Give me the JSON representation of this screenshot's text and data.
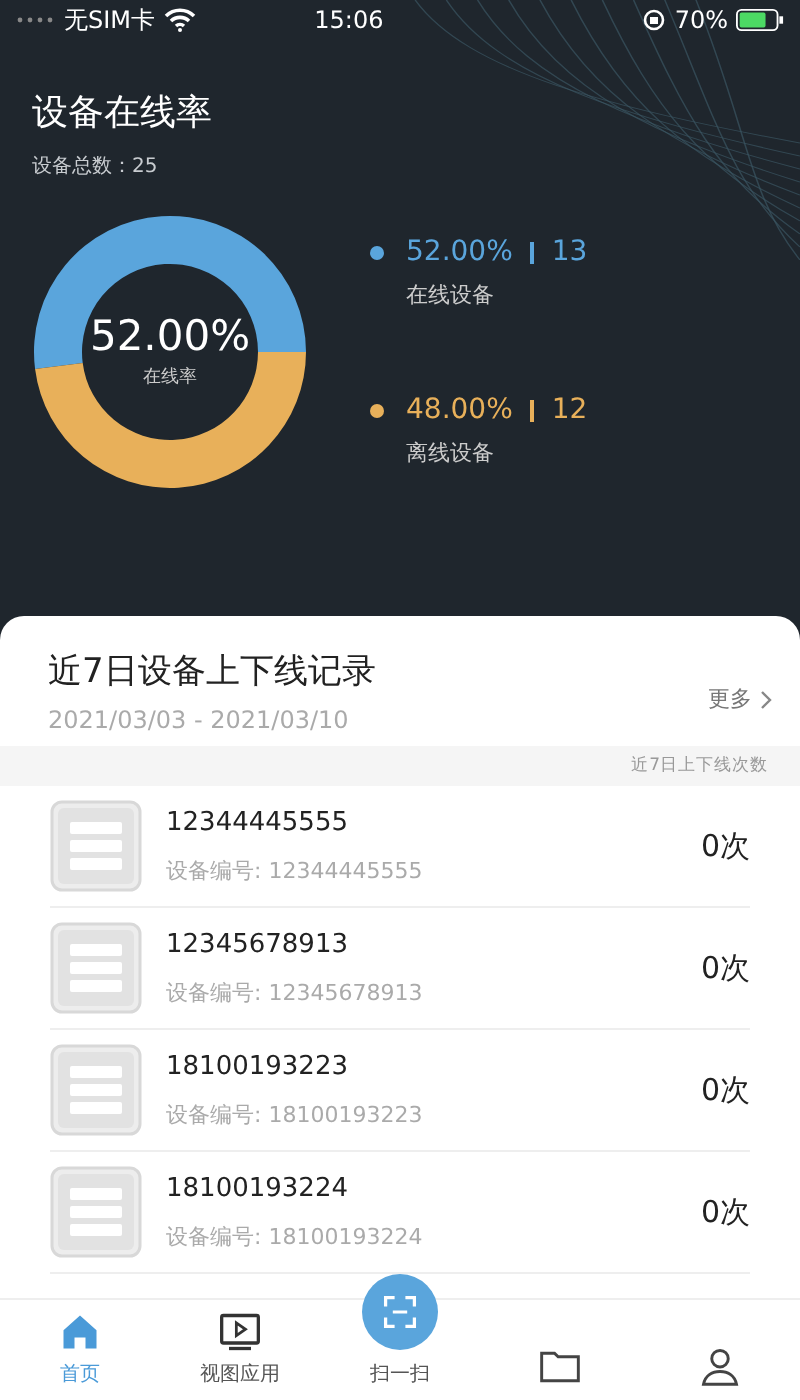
{
  "status_bar": {
    "carrier": "无SIM卡",
    "time": "15:06",
    "battery": "70%"
  },
  "summary": {
    "title": "设备在线率",
    "total": "设备总数：25",
    "center_value": "52.00%",
    "legend": [
      {
        "percent": "52.00%",
        "count": "13",
        "color": "#5aa5dc"
      },
      {
        "percent": "48.00%",
        "count": "12",
        "color": "#e8b05a"
      }
    ],
    "chart_data": {
      "type": "donut",
      "categories": [
        "在线设备",
        "离线设备"
      ],
      "series": [
        {
          "name": "在线率",
          "values": [
            52,
            48
          ]
        }
      ]
    }
  },
  "records": {
    "title": "近7日设备上下线记录",
    "date_range": "2021/03/03 - 2021/03/10",
    "more": "更多",
    "column_header": "近7日上下线次数",
    "rows": [
      {
        "name": "12344445555",
        "code": "设备编号: 12344445555",
        "count": "0次"
      },
      {
        "name": "12345678913",
        "code": "设备编号: 12345678913",
        "count": "0次"
      },
      {
        "name": "18100193223",
        "code": "设备编号: 18100193223",
        "count": "0次"
      },
      {
        "name": "18100193224",
        "code": "设备编号: 18100193224",
        "count": "0次"
      }
    ]
  },
  "tab_bar": [
    {
      "kind": "home",
      "label": "首页",
      "selected": true
    },
    {
      "kind": "video",
      "label": "视图应用",
      "selected": false
    },
    {
      "kind": "scan",
      "label": "扫一扫",
      "selected": false
    },
    {
      "kind": "folder",
      "selected": false
    },
    {
      "kind": "person",
      "selected": false
    }
  ]
}
